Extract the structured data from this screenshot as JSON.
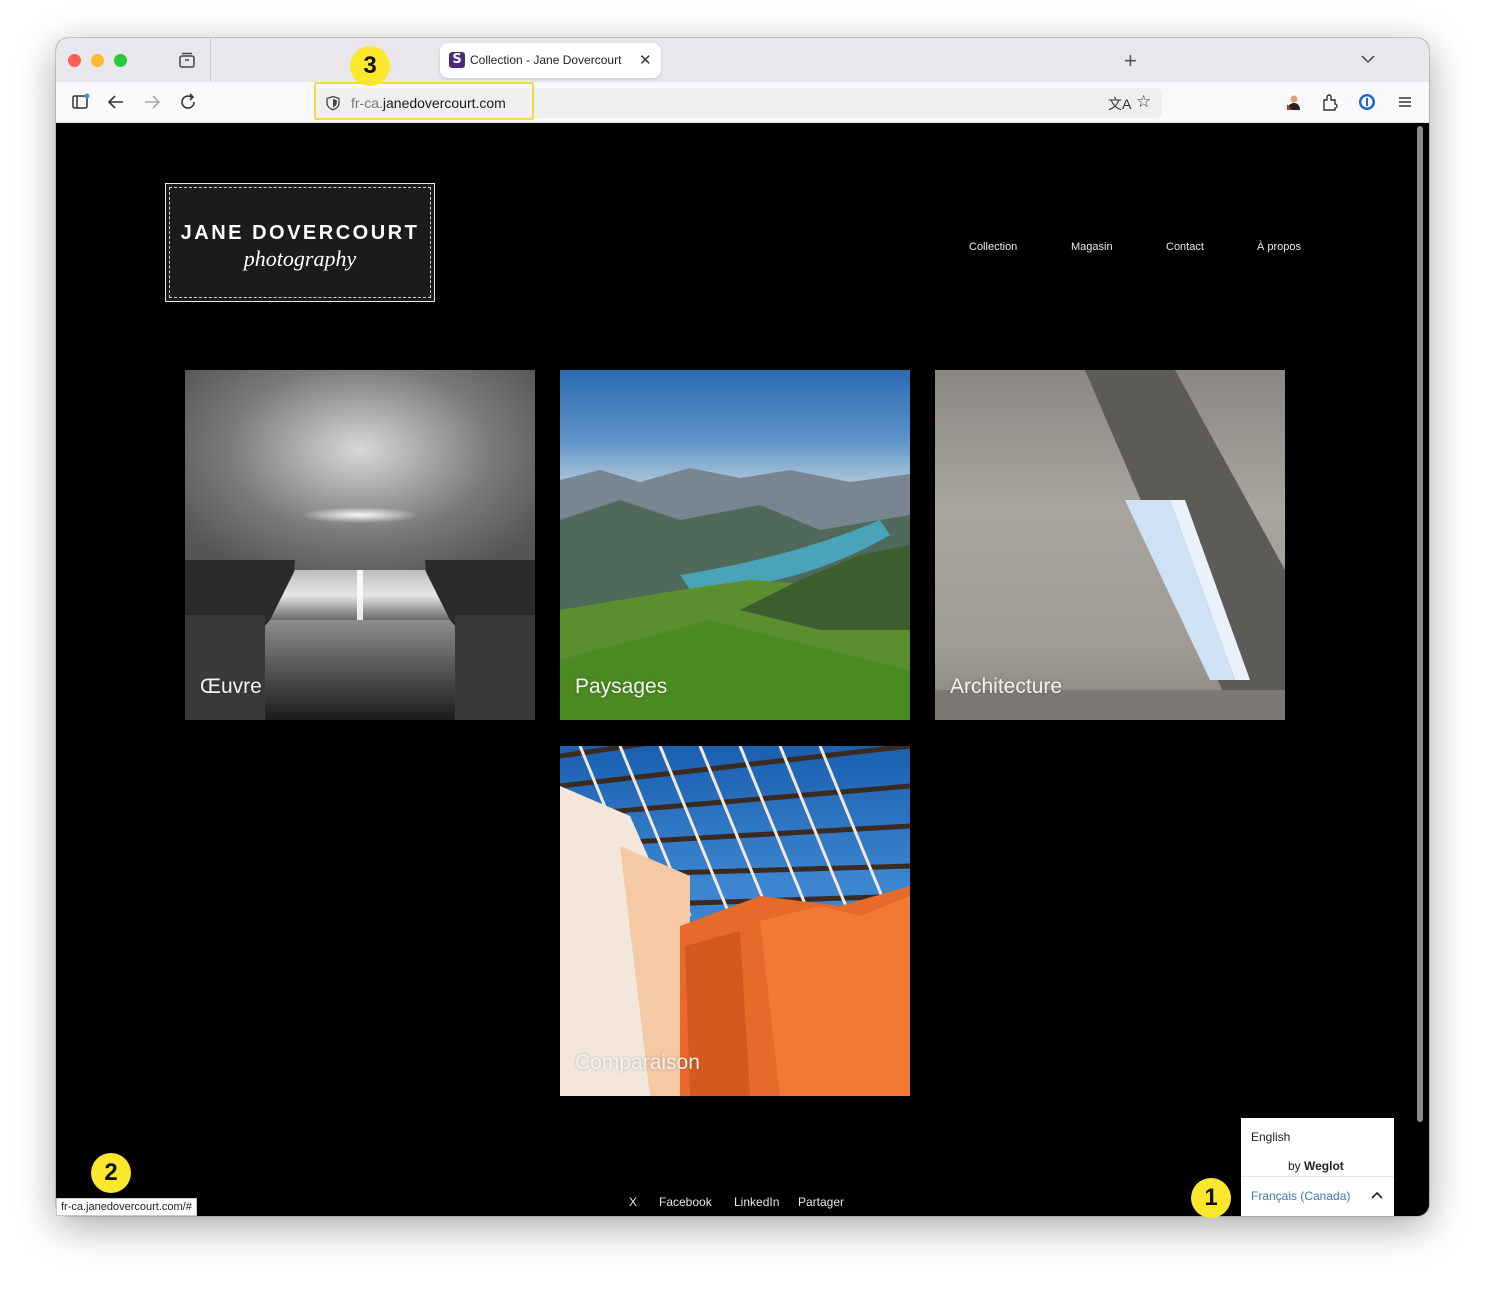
{
  "browser": {
    "tab_title": "Collection - Jane Dovercourt",
    "tab_favicon_letter": "S",
    "url_prefix": "fr-ca.",
    "url_domain": "janedovercourt.com",
    "status_url": "fr-ca.janedovercourt.com/#"
  },
  "site": {
    "logo_title": "JANE DOVERCOURT",
    "logo_subtitle": "photography",
    "nav": [
      "Collection",
      "Magasin",
      "Contact",
      "À propos"
    ],
    "tiles": [
      "Œuvre",
      "Paysages",
      "Architecture",
      "Comparaison"
    ],
    "footer_links": [
      "X",
      "Facebook",
      "LinkedIn",
      "Partager"
    ]
  },
  "weglot": {
    "option_english": "English",
    "by_prefix": "by ",
    "by_brand": "Weglot",
    "current_language": "Français (Canada)"
  },
  "callouts": [
    "1",
    "2",
    "3"
  ],
  "colors": {
    "callout": "#fbe72c",
    "weglot_link": "#3d79b3",
    "url_highlight": "#f5dc3c"
  }
}
